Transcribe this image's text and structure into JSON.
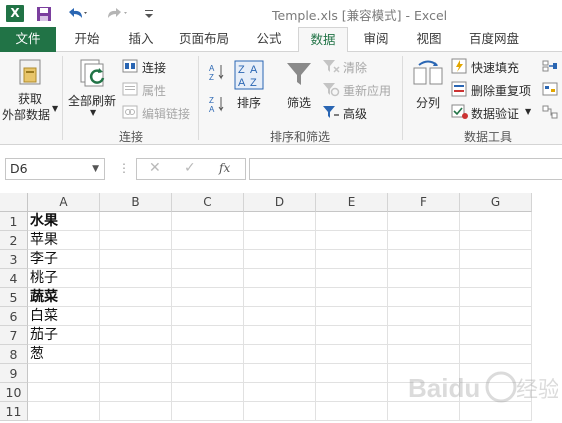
{
  "app": {
    "logo_letter": "X",
    "window_title": "Temple.xls  [兼容模式] - Excel"
  },
  "tabs": [
    {
      "label": "文件"
    },
    {
      "label": "开始"
    },
    {
      "label": "插入"
    },
    {
      "label": "页面布局"
    },
    {
      "label": "公式"
    },
    {
      "label": "数据"
    },
    {
      "label": "审阅"
    },
    {
      "label": "视图"
    },
    {
      "label": "百度网盘"
    }
  ],
  "ribbon": {
    "get_external": {
      "line1": "获取",
      "line2": "外部数据"
    },
    "refresh_all": "全部刷新",
    "connections": "连接",
    "properties": "属性",
    "edit_links": "编辑链接",
    "group_connections": "连接",
    "sort": "排序",
    "filter": "筛选",
    "clear": "清除",
    "reapply": "重新应用",
    "advanced": "高级",
    "group_sort_filter": "排序和筛选",
    "text_to_columns": "分列",
    "flash_fill": "快速填充",
    "remove_duplicates": "删除重复项",
    "data_validation": "数据验证",
    "group_data_tools": "数据工具"
  },
  "formula_bar": {
    "name_box": "D6",
    "fx": "fx",
    "value": ""
  },
  "columns": [
    "A",
    "B",
    "C",
    "D",
    "E",
    "F",
    "G"
  ],
  "rows": [
    {
      "num": "1",
      "a": "水果",
      "bold": true
    },
    {
      "num": "2",
      "a": "苹果",
      "bold": false
    },
    {
      "num": "3",
      "a": "李子",
      "bold": false
    },
    {
      "num": "4",
      "a": "桃子",
      "bold": false
    },
    {
      "num": "5",
      "a": "蔬菜",
      "bold": true
    },
    {
      "num": "6",
      "a": "白菜",
      "bold": false
    },
    {
      "num": "7",
      "a": "茄子",
      "bold": false
    },
    {
      "num": "8",
      "a": "葱",
      "bold": false
    },
    {
      "num": "9",
      "a": "",
      "bold": false
    },
    {
      "num": "10",
      "a": "",
      "bold": false
    },
    {
      "num": "11",
      "a": "",
      "bold": false
    }
  ],
  "watermark": {
    "brand": "Baidu",
    "text": "经验"
  },
  "colors": {
    "excel_green": "#217346",
    "ribbon_bg": "#f7f7f7"
  }
}
